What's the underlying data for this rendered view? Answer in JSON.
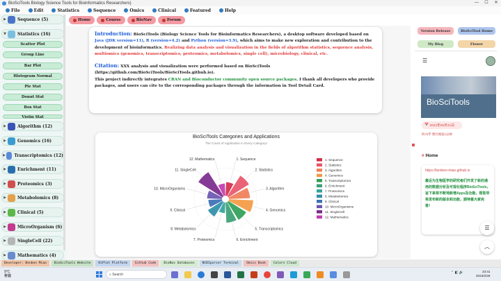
{
  "window": {
    "title": "BioSciTools Biology Science Tools for Bioinformatics Researchers)"
  },
  "menu": [
    "File",
    "Edit",
    "Statistics",
    "Sequence",
    "Omics",
    "Clinical",
    "Featured",
    "Help"
  ],
  "sidebar": {
    "categories": [
      {
        "label": "Sequence",
        "count": "(5)",
        "color": "#4a74c9"
      },
      {
        "label": "Statistics",
        "count": "(16)",
        "color": "#7bbfe0"
      },
      {
        "label": "Algorithm",
        "count": "(12)",
        "color": "#3a55b5"
      },
      {
        "label": "Genomics",
        "count": "(16)",
        "color": "#3b9bd1"
      },
      {
        "label": "Transcriptomics",
        "count": "(12)",
        "color": "#5b8bd8"
      },
      {
        "label": "Enrichment",
        "count": "(11)",
        "color": "#2a6fb0"
      },
      {
        "label": "Proteomics",
        "count": "(3)",
        "color": "#d05050"
      },
      {
        "label": "Metabolomics",
        "count": "(8)",
        "color": "#e3a24b"
      },
      {
        "label": "Clinical",
        "count": "(5)",
        "color": "#5db84a"
      },
      {
        "label": "MicroOrganism",
        "count": "(6)",
        "color": "#c23b8e"
      },
      {
        "label": "SingleCell",
        "count": "(22)",
        "color": "#b5b5b5"
      },
      {
        "label": "Mathematics",
        "count": "(4)",
        "color": "#6a8ccf"
      }
    ],
    "statistics_items": [
      "Scatter Plot",
      "Group Line",
      "Bar Plot",
      "Histogram Normal",
      "Pie Stat",
      "Donut Stat",
      "Box Stat",
      "Violin Stat"
    ]
  },
  "tabs": [
    "Home",
    "Course",
    "BioNav",
    "Forum"
  ],
  "intro": {
    "heading": "Introduction:",
    "t1": " BioSciTools (Biology Science Tools for Bioinformatics Researchers), a desktop software developed based on ",
    "java": "Java (JDK version=11)",
    "t2": ", ",
    "r": "R (version=4.2)",
    "t3": " and ",
    "python": "Python (version=3.9)",
    "t4": ", which aims to make new exploration and contribution to the development of bioinformatics. ",
    "realize": "Realizing data analysis and visualization in the fields of algorithm statistics, sequence analysis, multiomics (genomics, transcriptomics, proteomics, metabolomics, single cell), microbiology, clinical, etc."
  },
  "citation": {
    "heading": "Citation:",
    "t1": " XXX analysis and visualization were performed based on BioSciTools (https://github.com/BioSciTools/BioSciTools.github.io).",
    "t2": "This project indirectly integrates ",
    "cran": "CRAN and Bioconductor community open source packages",
    "t3": ". I thank all developers who provide packages, and users can cite to the corresponding packages through the information in Tool Detail Card."
  },
  "chart_data": {
    "type": "rose",
    "title": "BioSciTools Categories and Applications",
    "subtitle": "The Count of Application in Every Category!",
    "categories": [
      "1. Sequence",
      "2. Statistics",
      "3. Algorithm",
      "4. Genomics",
      "5. Transcriptomics",
      "6. Enrichment",
      "7. Proteomics",
      "8. Metabolomics",
      "9. Clinical",
      "10. MicroOrganisms",
      "11. SingleCell",
      "12. Mathematics"
    ],
    "values": [
      5,
      16,
      12,
      16,
      12,
      11,
      3,
      8,
      5,
      6,
      22,
      4
    ],
    "colors": [
      "#d62c4a",
      "#e8566b",
      "#f07e57",
      "#f39a43",
      "#2f9e56",
      "#3a9f73",
      "#35a29b",
      "#2f8ea8",
      "#3c6fb5",
      "#6a55b0",
      "#7b2a8c",
      "#c23ab0"
    ],
    "legend_position": "right"
  },
  "right": {
    "buttons": [
      "Version Release",
      "BioSciTool Home",
      "My Blog",
      "Flower"
    ],
    "hero_title": "BioSciTools",
    "date": "2022年05月31日",
    "stats": "约76字  预计阅读1分钟",
    "home_heading": "Home",
    "link": "https://benben-miao.github.io",
    "body": "最近为生物医学的研究者们开发了新的通用的数据分析及可视化程序BioSciTools，旨下来将不断地新增Apps及功能，帮助导将发布新的版本和功能，期待着大家完善！"
  },
  "strip": [
    {
      "label": "Developer: Benben Miao",
      "bg": "#f0c5a8"
    },
    {
      "label": "BioSciTools Website",
      "bg": "#c7e2c7"
    },
    {
      "label": "HiPlot Platform",
      "bg": "#c4d6f0"
    },
    {
      "label": "Github Code",
      "bg": "#f2c0c0"
    },
    {
      "label": "BioNav Databases",
      "bg": "#d4ecd0"
    },
    {
      "label": "NCBIparser Terminal",
      "bg": "#c8dcef"
    },
    {
      "label": "Omics Book",
      "bg": "#f1c3c0"
    },
    {
      "label": "Colors Cloud",
      "bg": "#cfe7cf"
    }
  ],
  "taskbar": {
    "temp": "9°C",
    "weather": "雾霾",
    "search": "Search",
    "time": "23:41",
    "date": "2023/2/28"
  }
}
